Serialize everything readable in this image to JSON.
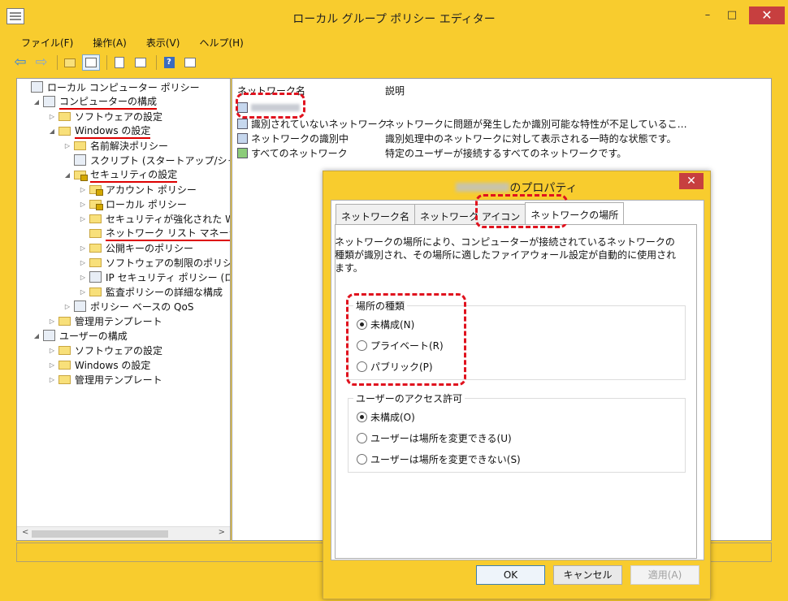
{
  "window": {
    "title": "ローカル グループ ポリシー エディター",
    "min": "–",
    "max": "□",
    "close": "✕"
  },
  "menu": [
    "ファイル(F)",
    "操作(A)",
    "表示(V)",
    "ヘルプ(H)"
  ],
  "tree": [
    {
      "label": "ローカル コンピューター ポリシー",
      "indent": 0,
      "twisty": "",
      "icon": "policy",
      "underline": false
    },
    {
      "label": "コンピューターの構成",
      "indent": 1,
      "twisty": "◢",
      "icon": "computer",
      "underline": true
    },
    {
      "label": "ソフトウェアの設定",
      "indent": 2,
      "twisty": "▷",
      "icon": "folder",
      "underline": false
    },
    {
      "label": "Windows の設定",
      "indent": 2,
      "twisty": "◢",
      "icon": "folder",
      "underline": true
    },
    {
      "label": "名前解決ポリシー",
      "indent": 3,
      "twisty": "▷",
      "icon": "folder",
      "underline": false
    },
    {
      "label": "スクリプト (スタートアップ/シャットダウン)",
      "indent": 3,
      "twisty": "",
      "icon": "script",
      "underline": false
    },
    {
      "label": "セキュリティの設定",
      "indent": 3,
      "twisty": "◢",
      "icon": "lock",
      "underline": true
    },
    {
      "label": "アカウント ポリシー",
      "indent": 4,
      "twisty": "▷",
      "icon": "lock",
      "underline": false
    },
    {
      "label": "ローカル ポリシー",
      "indent": 4,
      "twisty": "▷",
      "icon": "lock",
      "underline": false
    },
    {
      "label": "セキュリティが強化された Windows",
      "indent": 4,
      "twisty": "▷",
      "icon": "folder",
      "underline": false
    },
    {
      "label": "ネットワーク リスト マネージャー ポリシー",
      "indent": 4,
      "twisty": "",
      "icon": "folder",
      "underline": true
    },
    {
      "label": "公開キーのポリシー",
      "indent": 4,
      "twisty": "▷",
      "icon": "folder",
      "underline": false
    },
    {
      "label": "ソフトウェアの制限のポリシー",
      "indent": 4,
      "twisty": "▷",
      "icon": "folder",
      "underline": false
    },
    {
      "label": "IP セキュリティ ポリシー (ローカル",
      "indent": 4,
      "twisty": "▷",
      "icon": "shield",
      "underline": false
    },
    {
      "label": "監査ポリシーの詳細な構成",
      "indent": 4,
      "twisty": "▷",
      "icon": "folder",
      "underline": false
    },
    {
      "label": "ポリシー ベースの QoS",
      "indent": 3,
      "twisty": "▷",
      "icon": "chart",
      "underline": false
    },
    {
      "label": "管理用テンプレート",
      "indent": 2,
      "twisty": "▷",
      "icon": "folder",
      "underline": false
    },
    {
      "label": "ユーザーの構成",
      "indent": 1,
      "twisty": "◢",
      "icon": "user",
      "underline": false
    },
    {
      "label": "ソフトウェアの設定",
      "indent": 2,
      "twisty": "▷",
      "icon": "folder",
      "underline": false
    },
    {
      "label": "Windows の設定",
      "indent": 2,
      "twisty": "▷",
      "icon": "folder",
      "underline": false
    },
    {
      "label": "管理用テンプレート",
      "indent": 2,
      "twisty": "▷",
      "icon": "folder",
      "underline": false
    }
  ],
  "list": {
    "headers": {
      "name": "ネットワーク名",
      "desc": "説明"
    },
    "rows": [
      {
        "name": "",
        "desc": "",
        "blurred": true
      },
      {
        "name": "識別されていないネットワーク",
        "desc": "ネットワークに問題が発生したか識別可能な特性が不足していることが原因で、..."
      },
      {
        "name": "ネットワークの識別中",
        "desc": "識別処理中のネットワークに対して表示される一時的な状態です。"
      },
      {
        "name": "すべてのネットワーク",
        "desc": "特定のユーザーが接続するすべてのネットワークです。"
      }
    ]
  },
  "dialog": {
    "title_suffix": "のプロパティ",
    "close": "✕",
    "tabs": [
      "ネットワーク名",
      "ネットワーク アイコン",
      "ネットワークの場所"
    ],
    "intro": "ネットワークの場所により、コンピューターが接続されているネットワークの種類が識別され、その場所に適したファイアウォール設定が自動的に使用されます。",
    "location_group": {
      "label": "場所の種類",
      "options": [
        "未構成(N)",
        "プライベート(R)",
        "パブリック(P)"
      ],
      "selected": 0
    },
    "access_group": {
      "label": "ユーザーのアクセス許可",
      "options": [
        "未構成(O)",
        "ユーザーは場所を変更できる(U)",
        "ユーザーは場所を変更できない(S)"
      ],
      "selected": 0
    },
    "buttons": {
      "ok": "OK",
      "cancel": "キャンセル",
      "apply": "適用(A)"
    }
  },
  "colors": {
    "window_bg": "#f8cc2e",
    "annotation": "#e0121e",
    "close_red": "#c73f3f"
  }
}
